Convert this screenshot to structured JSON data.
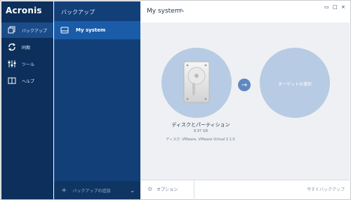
{
  "app": {
    "brand": "Acronis"
  },
  "leftnav": {
    "items": [
      {
        "label": "バックアップ",
        "icon": "copy-icon",
        "active": true
      },
      {
        "label": "同期",
        "icon": "sync-icon",
        "active": false
      },
      {
        "label": "ツール",
        "icon": "tools-icon",
        "active": false
      },
      {
        "label": "ヘルプ",
        "icon": "book-icon",
        "active": false
      }
    ]
  },
  "midpanel": {
    "title": "バックアップ",
    "selected_item": {
      "label": "My system",
      "icon": "drive-icon"
    },
    "bottom": {
      "add_label": "バックアップの追加"
    }
  },
  "main": {
    "title": "My system",
    "source": {
      "name": "ディスクとパーティション",
      "size": "8.97 GB",
      "desc": "ディスク: VMware, VMware Virtual S 1.0"
    },
    "target_label": "ターゲットの選択",
    "bottom": {
      "options_label": "オプション",
      "backup_now_label": "今すぐバックアップ"
    }
  },
  "colors": {
    "nav_bg": "#0c2f5b",
    "mid_bg": "#123f78",
    "selected_bg": "#1a5ca8",
    "circle": "#b7cbe4",
    "arrow": "#5f88bf"
  }
}
